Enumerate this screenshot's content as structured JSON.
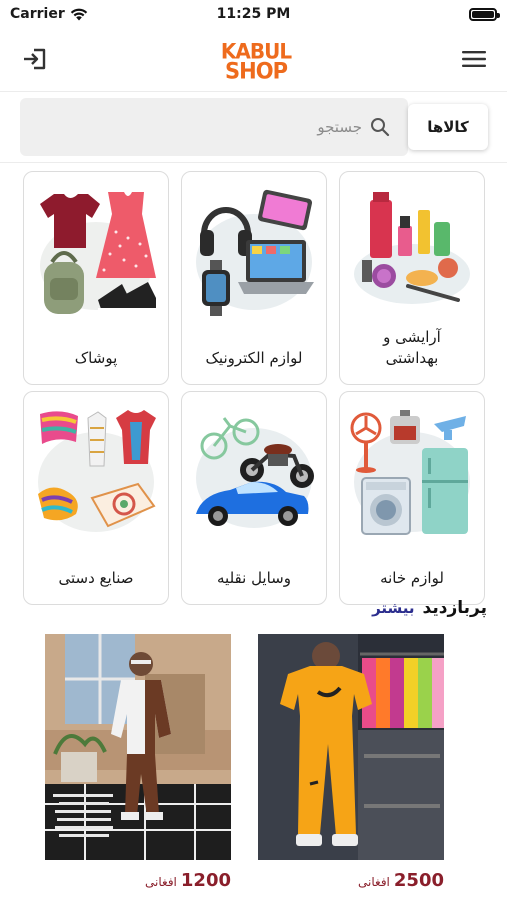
{
  "status": {
    "carrier": "Carrier",
    "time": "11:25 PM"
  },
  "header": {
    "logo_line1": "KABUL",
    "logo_line2": "SHOP"
  },
  "search": {
    "placeholder": "جستجو",
    "goods_button": "کالاها"
  },
  "categories": [
    {
      "label": "آرایشی و\nبهداشتی",
      "icon": "cosmetics-icon"
    },
    {
      "label": "لوازم الکترونیک",
      "icon": "electronics-icon"
    },
    {
      "label": "پوشاک",
      "icon": "clothing-icon"
    },
    {
      "label": "لوازم خانه",
      "icon": "home-appliances-icon"
    },
    {
      "label": "وسایل نقلیه",
      "icon": "vehicles-icon"
    },
    {
      "label": "صنایع دستی",
      "icon": "handicrafts-icon"
    }
  ],
  "section": {
    "title": "پربازدید",
    "more": "بیشتر"
  },
  "products": [
    {
      "price": "2500",
      "currency": "افغانی"
    },
    {
      "price": "1200",
      "currency": "افغانی"
    }
  ],
  "colors": {
    "brand": "#ee6b1d",
    "price": "#8a1f2b",
    "more_link": "#2c2e8e"
  }
}
